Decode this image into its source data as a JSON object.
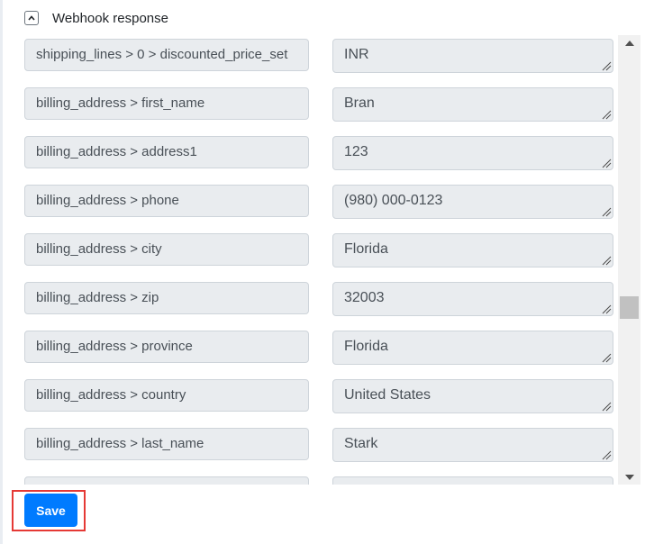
{
  "section": {
    "title": "Webhook response",
    "toggle_icon": "chevron-up-icon",
    "expanded": true
  },
  "fields": [
    {
      "key": "shipping_lines > 0 > discounted_price_set",
      "value": "INR"
    },
    {
      "key": "billing_address > first_name",
      "value": "Bran"
    },
    {
      "key": "billing_address > address1",
      "value": "123"
    },
    {
      "key": "billing_address > phone",
      "value": "(980) 000-0123"
    },
    {
      "key": "billing_address > city",
      "value": "Florida"
    },
    {
      "key": "billing_address > zip",
      "value": "32003"
    },
    {
      "key": "billing_address > province",
      "value": "Florida"
    },
    {
      "key": "billing_address > country",
      "value": "United States"
    },
    {
      "key": "billing_address > last_name",
      "value": "Stark"
    },
    {
      "key": "",
      "value": ""
    }
  ],
  "scrollbar": {
    "position_fraction": 0.62
  },
  "actions": {
    "save_label": "Save"
  },
  "colors": {
    "primary": "#007bff",
    "highlight_outline": "#e53935",
    "field_bg": "#e9ecef"
  }
}
